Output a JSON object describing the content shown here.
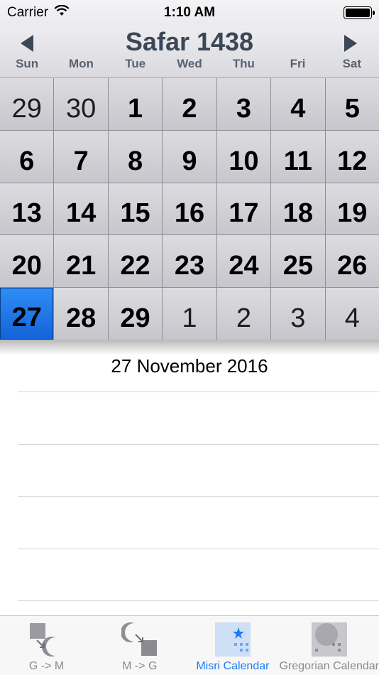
{
  "status_bar": {
    "carrier": "Carrier",
    "time": "1:10 AM"
  },
  "header": {
    "title": "Safar 1438",
    "prev_icon": "arrow-left",
    "next_icon": "arrow-right"
  },
  "weekdays": [
    "Sun",
    "Mon",
    "Tue",
    "Wed",
    "Thu",
    "Fri",
    "Sat"
  ],
  "calendar": {
    "rows": [
      [
        {
          "label": "29",
          "kind": "other"
        },
        {
          "label": "30",
          "kind": "other"
        },
        {
          "label": "1",
          "kind": "current"
        },
        {
          "label": "2",
          "kind": "current"
        },
        {
          "label": "3",
          "kind": "current"
        },
        {
          "label": "4",
          "kind": "current"
        },
        {
          "label": "5",
          "kind": "current"
        }
      ],
      [
        {
          "label": "6",
          "kind": "current"
        },
        {
          "label": "7",
          "kind": "current"
        },
        {
          "label": "8",
          "kind": "current"
        },
        {
          "label": "9",
          "kind": "current"
        },
        {
          "label": "10",
          "kind": "current"
        },
        {
          "label": "11",
          "kind": "current"
        },
        {
          "label": "12",
          "kind": "current"
        }
      ],
      [
        {
          "label": "13",
          "kind": "current"
        },
        {
          "label": "14",
          "kind": "current"
        },
        {
          "label": "15",
          "kind": "current"
        },
        {
          "label": "16",
          "kind": "current"
        },
        {
          "label": "17",
          "kind": "current"
        },
        {
          "label": "18",
          "kind": "current"
        },
        {
          "label": "19",
          "kind": "current"
        }
      ],
      [
        {
          "label": "20",
          "kind": "current"
        },
        {
          "label": "21",
          "kind": "current"
        },
        {
          "label": "22",
          "kind": "current"
        },
        {
          "label": "23",
          "kind": "current"
        },
        {
          "label": "24",
          "kind": "current"
        },
        {
          "label": "25",
          "kind": "current"
        },
        {
          "label": "26",
          "kind": "current"
        }
      ],
      [
        {
          "label": "27",
          "kind": "selected"
        },
        {
          "label": "28",
          "kind": "current"
        },
        {
          "label": "29",
          "kind": "current"
        },
        {
          "label": "1",
          "kind": "other"
        },
        {
          "label": "2",
          "kind": "other"
        },
        {
          "label": "3",
          "kind": "other"
        },
        {
          "label": "4",
          "kind": "other"
        }
      ]
    ]
  },
  "detail": {
    "selected_date": "27 November 2016"
  },
  "tab_bar": {
    "items": [
      {
        "label": "G -> M",
        "icon": "gregorian-to-misri-icon"
      },
      {
        "label": "M -> G",
        "icon": "misri-to-gregorian-icon"
      },
      {
        "label": "Misri Calendar",
        "icon": "misri-calendar-icon",
        "active": true
      },
      {
        "label": "Gregorian Calendar",
        "icon": "gregorian-calendar-icon"
      }
    ]
  },
  "colors": {
    "accent": "#1a7cf0",
    "selected_day": "#2f8df5",
    "title": "#3b4757"
  }
}
